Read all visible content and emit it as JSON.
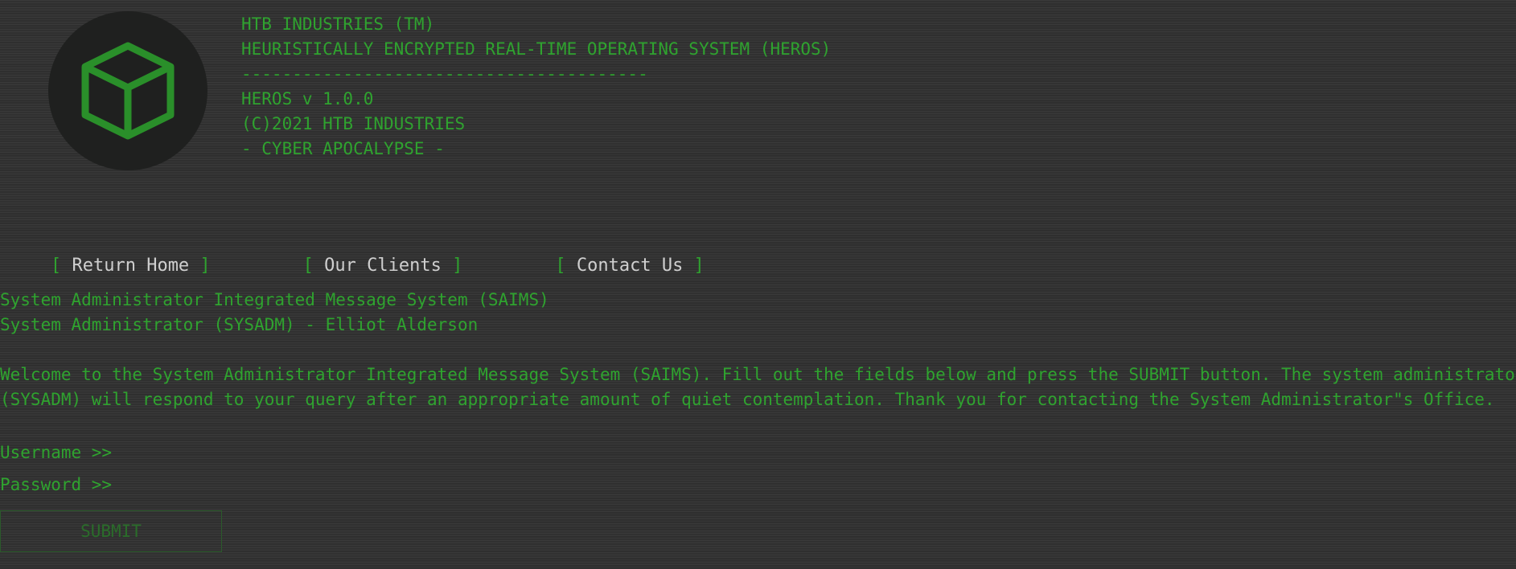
{
  "header": {
    "lines": [
      "HTB INDUSTRIES (TM)",
      "HEURISTICALLY ENCRYPTED REAL-TIME OPERATING SYSTEM (HEROS)",
      "----------------------------------------",
      "HEROS v 1.0.0",
      "(C)2021 HTB INDUSTRIES",
      "- CYBER APOCALYPSE -"
    ]
  },
  "logo": {
    "icon": "cube-icon",
    "color": "#2fa32f",
    "bg": "#1f201f"
  },
  "nav": {
    "items": [
      {
        "label": "Return Home"
      },
      {
        "label": "Our Clients"
      },
      {
        "label": "Contact Us"
      }
    ]
  },
  "system": {
    "title": "System Administrator Integrated Message System (SAIMS)",
    "admin": "System Administrator (SYSADM) - Elliot Alderson"
  },
  "welcome": {
    "line1": "Welcome to the System Administrator Integrated Message System (SAIMS). Fill out the fields below and press the SUBMIT button. The system administrator",
    "line2": "(SYSADM) will respond to your query after an appropriate amount of quiet contemplation. Thank you for contacting the System Administrator\"s Office."
  },
  "form": {
    "username_label": "Username >>",
    "username_value": "",
    "password_label": "Password >>",
    "password_value": "",
    "submit_label": "SUBMIT"
  },
  "colors": {
    "accent": "#2fa32f",
    "nav_text": "#cfcfcf",
    "submit_border": "#2b5a2b",
    "submit_text": "#2a6d2a"
  }
}
